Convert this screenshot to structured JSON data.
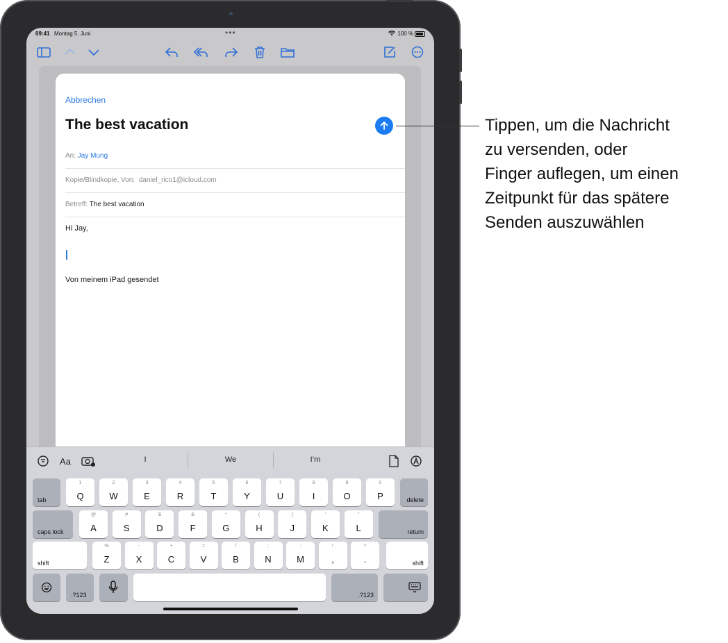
{
  "status_bar": {
    "time": "09:41",
    "date": "Montag 5. Juni",
    "battery": "100 %"
  },
  "toolbar": {
    "icons": [
      "sidebar-icon",
      "chevron-up-icon",
      "chevron-down-icon",
      "reply-icon",
      "reply-all-icon",
      "forward-icon",
      "trash-icon",
      "folder-icon",
      "compose-icon",
      "more-icon"
    ]
  },
  "compose": {
    "cancel_label": "Abbrechen",
    "subject_title": "The best vacation",
    "to_label": "An:",
    "to_value": "Jay Mung",
    "cc_label": "Kopie/Blindkopie, Von:",
    "cc_value": "daniel_rico1@icloud.com",
    "subject_label": "Betreff:",
    "subject_value": "The best vacation",
    "body_greeting": "Hi Jay,",
    "signature": "Von meinem iPad gesendet",
    "accent_color": "#1a7bf2"
  },
  "quicktype": {
    "format_label": "Aa",
    "suggestions": [
      "I",
      "We",
      "I’m"
    ]
  },
  "keyboard": {
    "row1": [
      {
        "hint": "1",
        "key": "Q"
      },
      {
        "hint": "2",
        "key": "W"
      },
      {
        "hint": "3",
        "key": "E"
      },
      {
        "hint": "4",
        "key": "R"
      },
      {
        "hint": "5",
        "key": "T"
      },
      {
        "hint": "6",
        "key": "Y"
      },
      {
        "hint": "7",
        "key": "U"
      },
      {
        "hint": "8",
        "key": "I"
      },
      {
        "hint": "9",
        "key": "O"
      },
      {
        "hint": "0",
        "key": "P"
      }
    ],
    "row2": [
      {
        "hint": "@",
        "key": "A"
      },
      {
        "hint": "#",
        "key": "S"
      },
      {
        "hint": "$",
        "key": "D"
      },
      {
        "hint": "&",
        "key": "F"
      },
      {
        "hint": "*",
        "key": "G"
      },
      {
        "hint": "(",
        "key": "H"
      },
      {
        "hint": ")",
        "key": "J"
      },
      {
        "hint": "’",
        "key": "K"
      },
      {
        "hint": "\"",
        "key": "L"
      }
    ],
    "row3": [
      {
        "hint": "%",
        "key": "Z"
      },
      {
        "hint": "-",
        "key": "X"
      },
      {
        "hint": "+",
        "key": "C"
      },
      {
        "hint": "=",
        "key": "V"
      },
      {
        "hint": "/",
        "key": "B"
      },
      {
        "hint": ";",
        "key": "N"
      },
      {
        "hint": ":",
        "key": "M"
      },
      {
        "hint": "!",
        "key": ","
      },
      {
        "hint": "?",
        "key": "."
      }
    ],
    "tab_label": "tab",
    "delete_label": "delete",
    "caps_label": "caps lock",
    "return_label": "return",
    "shift_label": "shift",
    "numbers_label": ".?123"
  },
  "annotation": {
    "line1": "Tippen, um die Nachricht",
    "line2": "zu versenden, oder",
    "line3": "Finger auflegen, um einen",
    "line4": "Zeitpunkt für das spätere",
    "line5": "Senden auszuwählen"
  }
}
